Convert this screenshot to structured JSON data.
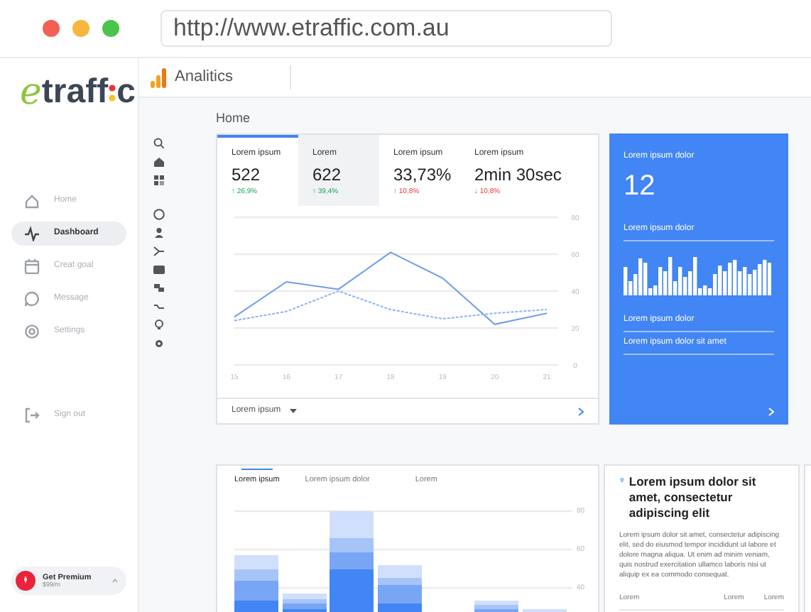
{
  "browser": {
    "url": "http://www.etraffic.com.au"
  },
  "logo": {
    "lead": "e",
    "middle": "traff",
    "tail": "c"
  },
  "sidebar": {
    "items": [
      {
        "label": "Home",
        "selected": false
      },
      {
        "label": "Dashboard",
        "selected": true
      },
      {
        "label": "Creat goal",
        "selected": false
      },
      {
        "label": "Message",
        "selected": false
      },
      {
        "label": "Settings",
        "selected": false
      }
    ],
    "signout": {
      "label": "Sign out"
    },
    "premium": {
      "title": "Get Premium",
      "price": "$99/m"
    }
  },
  "header": {
    "title": "Analitics"
  },
  "page_title": "Home",
  "metrics": [
    {
      "label": "Lorem ipsum",
      "value": "522",
      "delta": "↑ 26,9%",
      "positive": true,
      "selected": true,
      "highlighted": false
    },
    {
      "label": "Lorem",
      "value": "622",
      "delta": "↑ 39,4%",
      "positive": true,
      "selected": false,
      "highlighted": true
    },
    {
      "label": "Lorem ipsum",
      "value": "33,73%",
      "delta": "↑ 10,8%",
      "positive": false,
      "selected": false,
      "highlighted": false
    },
    {
      "label": "Lorem ipsum",
      "value": "2min 30sec",
      "delta": "↓ 10,8%",
      "positive": false,
      "selected": false,
      "highlighted": false
    }
  ],
  "line_chart": {
    "chart_data": {
      "type": "line",
      "categories": [
        "15",
        "16",
        "17",
        "18",
        "19",
        "20",
        "21"
      ],
      "series": [
        {
          "color": "#6f9cf0",
          "line_style": "solid",
          "values": [
            26,
            45,
            41,
            61,
            47,
            22,
            28
          ]
        },
        {
          "color": "#8fb2f3",
          "line_style": "dashed",
          "values": [
            24,
            29,
            40,
            30,
            25,
            28,
            30
          ]
        }
      ],
      "ylim": [
        0,
        80
      ],
      "yticks": [
        0,
        20,
        40,
        60,
        80
      ],
      "grid": true
    },
    "footer_label": "Lorem ipsum"
  },
  "blue_card": {
    "label": "Lorem ipsum dolor",
    "value": "12",
    "chart_label": "Lorem ipsum dolor",
    "rows": [
      "Lorem ipsum dolor",
      "Lorem ipsum dolor sit amet"
    ]
  },
  "bar_card": {
    "tabs": [
      {
        "label": "Lorem ipsum",
        "selected": true
      },
      {
        "label": "Lorem ipsum dolor",
        "selected": false
      },
      {
        "label": "Lorem",
        "selected": false
      }
    ],
    "axis_labels": [
      "80",
      "60",
      "40"
    ]
  },
  "text_card": {
    "title": "Lorem ipsum dolor sit amet, consectetur adipiscing elit",
    "body": "Lorem ipsum dolor sit amet, consectetur adipiscing elit, sed do eiusmod tempor incididunt ut labore et dolore magna aliqua. Ut enim ad minim veniam, quis nostrud exercitation ullamco laboris nisi ut aliquip ex ea commodo consequat.",
    "columns": [
      "Lorem",
      "Lorem",
      "Lorem"
    ]
  }
}
